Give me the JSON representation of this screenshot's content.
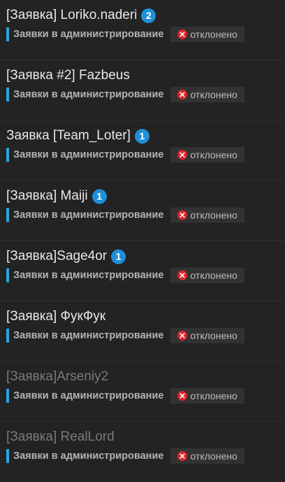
{
  "threads": [
    {
      "title": "[Заявка] Loriko.naderi",
      "badge": "2",
      "read": false,
      "forum": "Заявки в администрирование",
      "status": "отклонено"
    },
    {
      "title": "[Заявка #2] Fazbeus",
      "badge": null,
      "read": false,
      "forum": "Заявки в администрирование",
      "status": "отклонено"
    },
    {
      "title": "Заявка [Team_Loter]",
      "badge": "1",
      "read": false,
      "forum": "Заявки в администрирование",
      "status": "отклонено"
    },
    {
      "title": "[Заявка] Maiji",
      "badge": "1",
      "read": false,
      "forum": "Заявки в администрирование",
      "status": "отклонено"
    },
    {
      "title": "[Заявка]Sage4or",
      "badge": "1",
      "read": false,
      "forum": "Заявки в администрирование",
      "status": "отклонено"
    },
    {
      "title": "[Заявка] ФукФук",
      "badge": null,
      "read": false,
      "forum": "Заявки в администрирование",
      "status": "отклонено"
    },
    {
      "title": "[Заявка]Arseniy2",
      "badge": null,
      "read": true,
      "forum": "Заявки в администрирование",
      "status": "отклонено"
    },
    {
      "title": "[Заявка] RealLord",
      "badge": null,
      "read": true,
      "forum": "Заявки в администрирование",
      "status": "отклонено"
    }
  ],
  "colors": {
    "background": "#232323",
    "badge": "#1f8fd8",
    "forum_bar": "#2aa5e0",
    "status_icon": "#d8242b"
  },
  "icons": {
    "status": "x-circle-icon"
  }
}
